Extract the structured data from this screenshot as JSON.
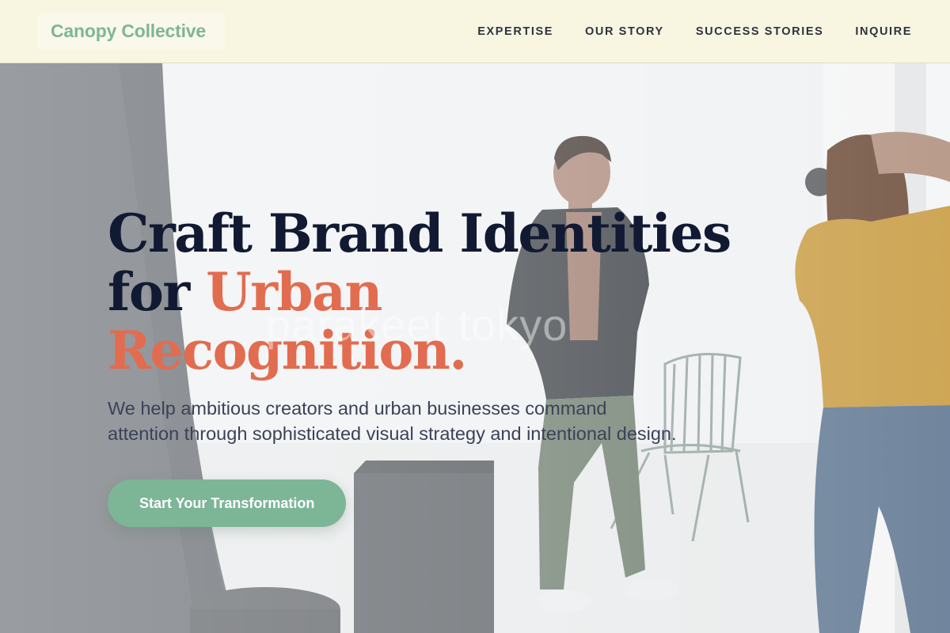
{
  "brand": {
    "name": "Canopy Collective",
    "accent_color": "#7fb596"
  },
  "nav": {
    "items": [
      {
        "label": "EXPERTISE"
      },
      {
        "label": "OUR STORY"
      },
      {
        "label": "SUCCESS STORIES"
      },
      {
        "label": "INQUIRE"
      }
    ]
  },
  "hero": {
    "headline_line1": "Craft Brand Identities",
    "headline_line2_prefix": "for ",
    "headline_line2_accent": "Urban Recognition.",
    "accent_color": "#e26c4f",
    "subtext": "We help ambitious creators and urban businesses command attention through sophisticated visual strategy and intentional design.",
    "cta_label": "Start Your Transformation",
    "cta_color": "#7db597",
    "watermark": "parakeet tokyo"
  }
}
